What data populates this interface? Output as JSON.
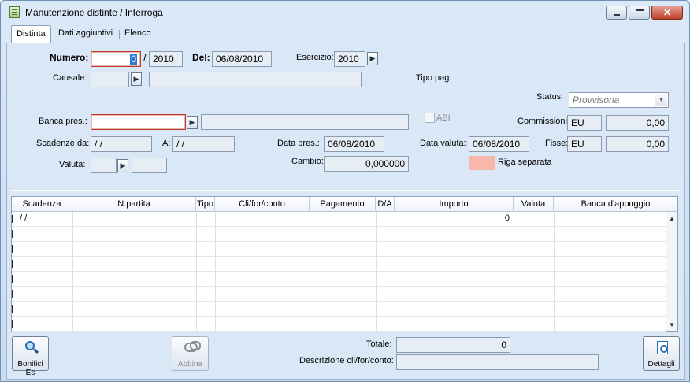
{
  "window": {
    "title": "Manutenzione distinte / Interroga"
  },
  "tabs": [
    {
      "label": "Distinta"
    },
    {
      "label": "Dati aggiuntivi"
    },
    {
      "label": "Elenco"
    }
  ],
  "form": {
    "numero_label": "Numero:",
    "numero_value": "0",
    "numero_sep": "/",
    "numero_year": "2010",
    "del_label": "Del:",
    "del_value": "06/08/2010",
    "esercizio_label": "Esercizio:",
    "esercizio_value": "2010",
    "causale_label": "Causale:",
    "causale_code": "",
    "causale_desc": "",
    "tipo_pag_label": "Tipo pag:",
    "status_label": "Status:",
    "status_value": "Provvisoria",
    "banca_label": "Banca pres.:",
    "banca_code": "",
    "banca_desc": "",
    "abi_label": "ABI",
    "commissioni_label": "Commissioni:",
    "commissioni_currency": "EU",
    "commissioni_value": "0,00",
    "scadenze_da_label": "Scadenze da:",
    "scadenze_da_value": " /  /",
    "a_label": "A:",
    "a_value": " /  /",
    "data_pres_label": "Data pres.:",
    "data_pres_value": "06/08/2010",
    "data_valuta_label": "Data valuta:",
    "data_valuta_value": "06/08/2010",
    "fisse_label": "Fisse:",
    "fisse_currency": "EU",
    "fisse_value": "0,00",
    "valuta_label": "Valuta:",
    "valuta_code": "",
    "valuta_desc": "",
    "cambio_label": "Cambio:",
    "cambio_value": "0,000000",
    "riga_separata_label": "Riga separata",
    "riga_separata_color": "#f7b8ab"
  },
  "grid": {
    "columns": [
      "Scadenza",
      "N.partita",
      "Tipo",
      "Cli/for/conto",
      "Pagamento",
      "D/A",
      "Importo",
      "Valuta",
      "Banca d'appoggio"
    ],
    "first_row": {
      "scadenza": " /  /",
      "importo": "0"
    }
  },
  "footer": {
    "bonifici_label": "Bonifici Es",
    "abbina_label": "Abbina",
    "dettagli_label": "Dettagli",
    "totale_label": "Totale:",
    "totale_value": "0",
    "descrizione_label": "Descrizione cli/for/conto:",
    "descrizione_value": ""
  }
}
